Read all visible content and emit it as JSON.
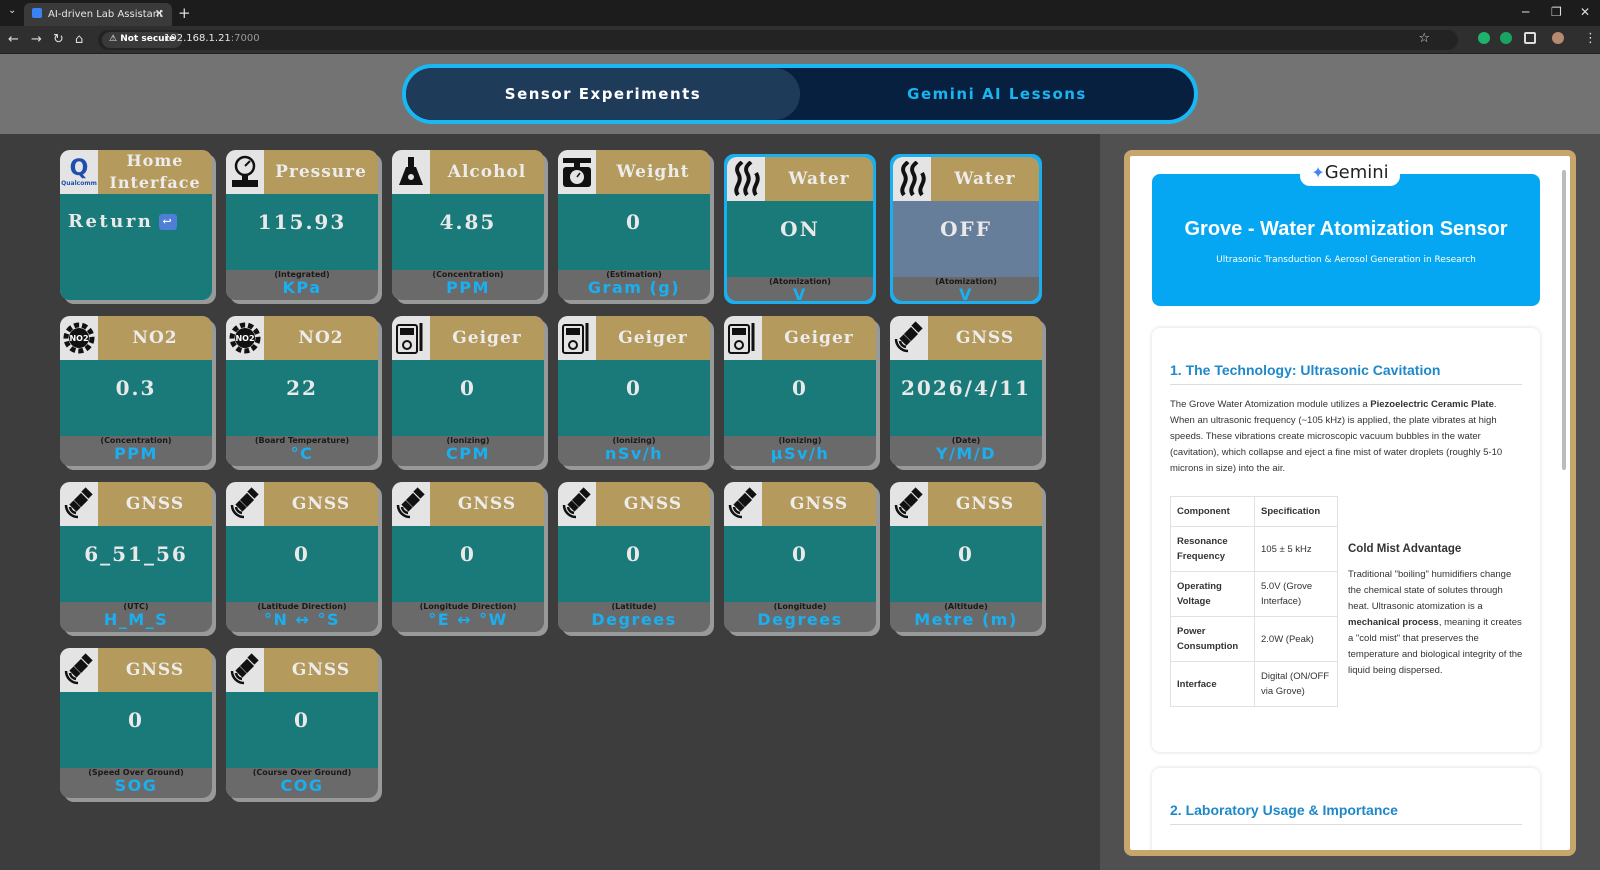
{
  "browser": {
    "tab_title": "AI-driven Lab Assistant",
    "security": "Not secure",
    "url_host": "192.168.1.21",
    "url_port": ":7000"
  },
  "header": {
    "left_tab": "Sensor Experiments",
    "right_tab": "Gemini AI Lessons"
  },
  "cards": [
    {
      "id": "home",
      "title": "Home Interface",
      "value": "Return",
      "sub": "",
      "unit": "",
      "icon": "qualcomm-logo"
    },
    {
      "id": "pressure",
      "title": "Pressure",
      "value": "115.93",
      "sub": "(Integrated)",
      "unit": "KPa",
      "icon": "pressure-gauge-icon"
    },
    {
      "id": "alcohol",
      "title": "Alcohol",
      "value": "4.85",
      "sub": "(Concentration)",
      "unit": "PPM",
      "icon": "flask-icon"
    },
    {
      "id": "weight",
      "title": "Weight",
      "value": "0",
      "sub": "(Estimation)",
      "unit": "Gram (g)",
      "icon": "scale-icon"
    },
    {
      "id": "water-on",
      "title": "Water",
      "value": "ON",
      "sub": "(Atomization)",
      "unit": "V",
      "icon": "steam-icon"
    },
    {
      "id": "water-off",
      "title": "Water",
      "value": "OFF",
      "sub": "(Atomization)",
      "unit": "V",
      "icon": "steam-icon"
    },
    {
      "id": "no2-ppm",
      "title": "NO2",
      "value": "0.3",
      "sub": "(Concentration)",
      "unit": "PPM",
      "icon": "no2-gear-icon"
    },
    {
      "id": "no2-temp",
      "title": "NO2",
      "value": "22",
      "sub": "(Board Temperature)",
      "unit": "°C",
      "icon": "no2-gear-icon"
    },
    {
      "id": "geiger-cpm",
      "title": "Geiger",
      "value": "0",
      "sub": "(Ionizing)",
      "unit": "CPM",
      "icon": "geiger-counter-icon"
    },
    {
      "id": "geiger-nsv",
      "title": "Geiger",
      "value": "0",
      "sub": "(Ionizing)",
      "unit": "nSv/h",
      "icon": "geiger-counter-icon"
    },
    {
      "id": "geiger-usv",
      "title": "Geiger",
      "value": "0",
      "sub": "(Ionizing)",
      "unit": "μSv/h",
      "icon": "geiger-counter-icon"
    },
    {
      "id": "gnss-date",
      "title": "GNSS",
      "value": "2026/4/11",
      "sub": "(Date)",
      "unit": "Y/M/D",
      "icon": "satellite-icon"
    },
    {
      "id": "gnss-utc",
      "title": "GNSS",
      "value": "6_51_56",
      "sub": "(UTC)",
      "unit": "H_M_S",
      "icon": "satellite-icon"
    },
    {
      "id": "gnss-latdir",
      "title": "GNSS",
      "value": "0",
      "sub": "(Latitude Direction)",
      "unit": "°N ↔ °S",
      "icon": "satellite-icon"
    },
    {
      "id": "gnss-londir",
      "title": "GNSS",
      "value": "0",
      "sub": "(Longitude Direction)",
      "unit": "°E ↔ °W",
      "icon": "satellite-icon"
    },
    {
      "id": "gnss-lat",
      "title": "GNSS",
      "value": "0",
      "sub": "(Latitude)",
      "unit": "Degrees",
      "icon": "satellite-icon"
    },
    {
      "id": "gnss-lon",
      "title": "GNSS",
      "value": "0",
      "sub": "(Longitude)",
      "unit": "Degrees",
      "icon": "satellite-icon"
    },
    {
      "id": "gnss-alt",
      "title": "GNSS",
      "value": "0",
      "sub": "(Altitude)",
      "unit": "Metre (m)",
      "icon": "satellite-icon"
    },
    {
      "id": "gnss-sog",
      "title": "GNSS",
      "value": "0",
      "sub": "(Speed Over Ground)",
      "unit": "SOG",
      "icon": "satellite-icon"
    },
    {
      "id": "gnss-cog",
      "title": "GNSS",
      "value": "0",
      "sub": "(Course Over Ground)",
      "unit": "COG",
      "icon": "satellite-icon"
    }
  ],
  "lesson": {
    "logo_text": "Gemini",
    "title": "Grove - Water Atomization Sensor",
    "subtitle": "Ultrasonic Transduction & Aerosol Generation in Research",
    "section1_title": "1. The Technology: Ultrasonic Cavitation",
    "section1_intro": "The Grove Water Atomization module utilizes a ",
    "section1_bold": "Piezoelectric Ceramic Plate",
    "section1_rest": ". When an ultrasonic frequency (~105 kHz) is applied, the plate vibrates at high speeds. These vibrations create microscopic vacuum bubbles in the water (cavitation), which collapse and eject a fine mist of water droplets (roughly 5-10 microns in size) into the air.",
    "table_head": [
      "Component",
      "Specification"
    ],
    "table_rows": [
      [
        "Resonance Frequency",
        "105 ± 5 kHz"
      ],
      [
        "Operating Voltage",
        "5.0V (Grove Interface)"
      ],
      [
        "Power Consumption",
        "2.0W (Peak)"
      ],
      [
        "Interface",
        "Digital (ON/OFF via Grove)"
      ]
    ],
    "side_title": "Cold Mist Advantage",
    "side_p1": "Traditional \"boiling\" humidifiers change the chemical state of solutes through heat. Ultrasonic atomization is a ",
    "side_bold": "mechanical process",
    "side_p2": ", meaning it creates a \"cold mist\" that preserves the temperature and biological integrity of the liquid being dispersed.",
    "section2_title": "2. Laboratory Usage & Importance"
  }
}
